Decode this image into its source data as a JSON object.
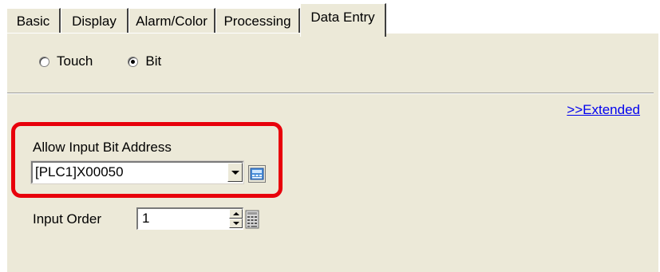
{
  "tabs": [
    {
      "label": "Basic"
    },
    {
      "label": "Display"
    },
    {
      "label": "Alarm/Color"
    },
    {
      "label": "Processing"
    },
    {
      "label": "Data Entry"
    }
  ],
  "active_tab": "Data Entry",
  "mode": {
    "options": [
      {
        "label": "Touch",
        "selected": false
      },
      {
        "label": "Bit",
        "selected": true
      }
    ]
  },
  "extended_link": ">>Extended",
  "allow_input": {
    "label": "Allow Input Bit Address",
    "value": "[PLC1]X00050"
  },
  "input_order": {
    "label": "Input Order",
    "value": "1"
  },
  "colors": {
    "highlight": "#e8000b",
    "panel": "#ece9d8",
    "link": "#0000ee"
  },
  "icons": [
    "address-input-icon",
    "keypad-icon",
    "dropdown-arrow-icon",
    "spin-up-icon",
    "spin-down-icon"
  ]
}
